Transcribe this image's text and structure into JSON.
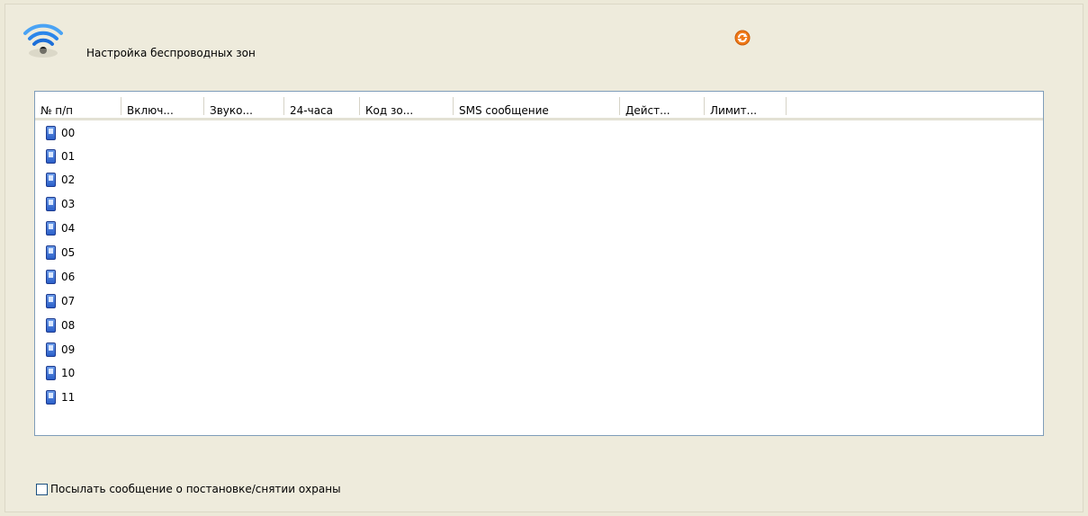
{
  "panel": {
    "title": "Настройка беспроводных зон",
    "wifi_icon": "wifi-icon",
    "refresh_icon": "refresh-icon"
  },
  "table": {
    "columns": [
      "№ п/п",
      "Включ...",
      "Звуко...",
      "24-часа",
      "Код зо...",
      "SMS сообщение",
      "Дейст...",
      "Лимит..."
    ],
    "rows": [
      "00",
      "01",
      "02",
      "03",
      "04",
      "05",
      "06",
      "07",
      "08",
      "09",
      "10",
      "11"
    ],
    "row_icon": "zone-device-icon"
  },
  "footer": {
    "checkbox_label": "Посылать сообщение о постановке/снятии охраны",
    "checkbox_checked": false
  },
  "colors": {
    "background": "#ece9d8",
    "list_border": "#7f9db9",
    "icon_blue": "#2b5fc9",
    "refresh_orange": "#f07a1a"
  }
}
